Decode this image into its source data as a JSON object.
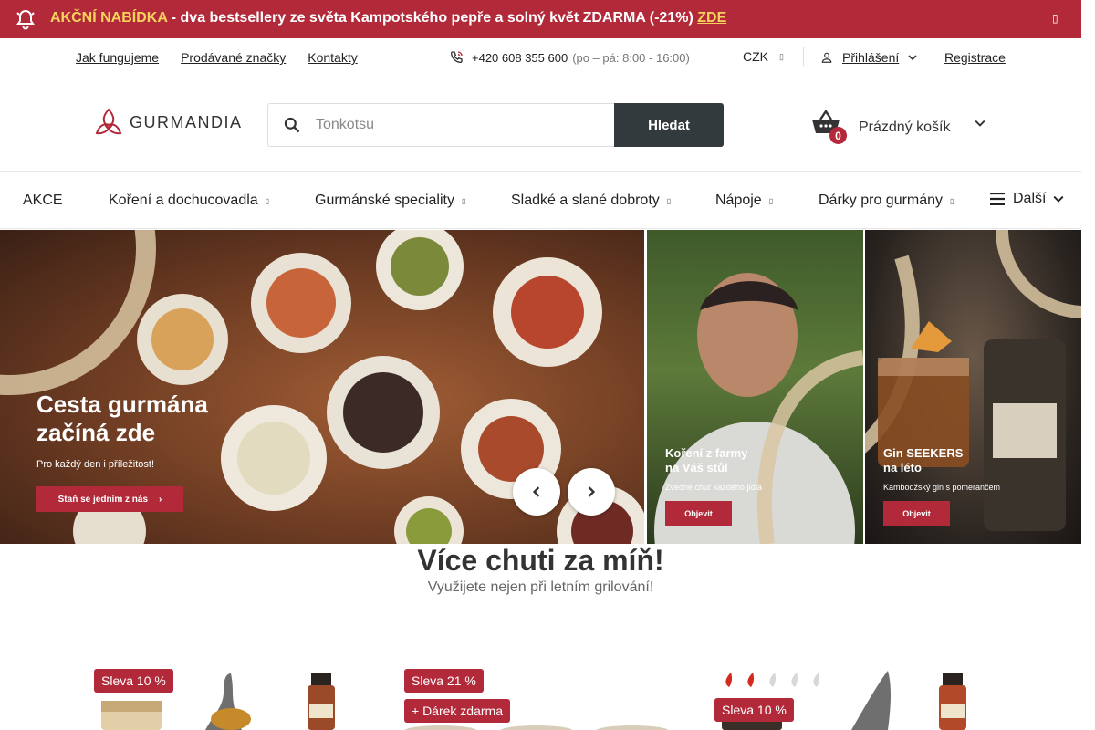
{
  "promo": {
    "label": "AKČNÍ NABÍDKA",
    "text": " - dva bestsellery ze světa Kampotského pepře a solný květ ZDARMA (-21%) ",
    "link": "ZDE",
    "close_icon": "close-icon"
  },
  "top_links": [
    "Jak fungujeme",
    "Prodávané značky",
    "Kontakty"
  ],
  "contact": {
    "phone": "+420 608 355 600",
    "hours": "(po – pá: 8:00 - 16:00)"
  },
  "currency": "CZK",
  "login": "Přihlášení",
  "register": "Registrace",
  "logo_text": "GURMANDIA",
  "search": {
    "placeholder": "Tonkotsu",
    "button": "Hledat"
  },
  "cart": {
    "count": "0",
    "label": "Prázdný košík"
  },
  "nav": {
    "items": [
      "AKCE",
      "Koření a dochucovadla",
      "Gurmánské speciality",
      "Sladké a slané dobroty",
      "Nápoje",
      "Dárky pro gurmány"
    ],
    "more": "Další"
  },
  "banners": {
    "main": {
      "title_line1": "Cesta gurmána",
      "title_line2": "začíná zde",
      "subtitle": "Pro každý den i příležitost!",
      "button": "Staň se jedním z nás"
    },
    "farm": {
      "title_line1": "Koření z farmy",
      "title_line2": "na Váš stůl",
      "subtitle": "Zvedne chuť každého jídla",
      "button": "Objevit"
    },
    "gin": {
      "title_line1": "Gin SEEKERS",
      "title_line2": "na léto",
      "subtitle": "Kambodžský gin s pomerančem",
      "button": "Objevit"
    }
  },
  "section": {
    "title": "Více chuti za míň!",
    "subtitle": "Využijete nejen při letním grilování!"
  },
  "products": [
    {
      "tags": [
        "Sleva 10 %"
      ]
    },
    {
      "tags": [
        "Sleva 21 %",
        "+ Dárek zdarma"
      ]
    },
    {
      "tags": [
        "Sleva 10 %"
      ],
      "heat_level": "2/5"
    }
  ],
  "colors": {
    "brand": "#b22a3a",
    "dark_button": "#333a3e",
    "accent_link": "#f6d35a"
  }
}
